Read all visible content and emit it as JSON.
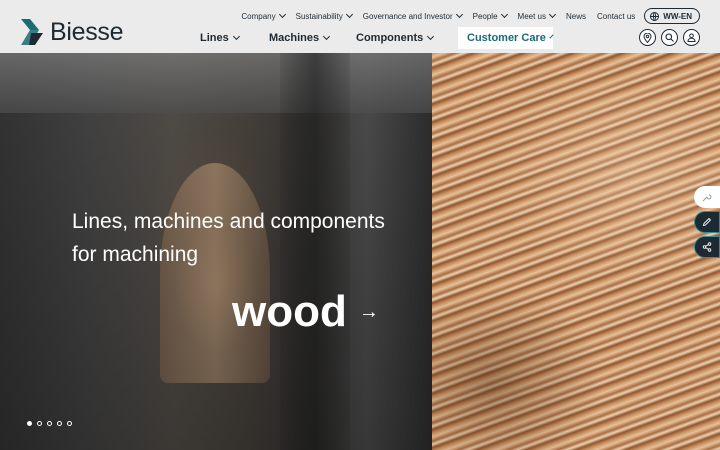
{
  "brand": {
    "name": "Biesse",
    "accent": "#1b6b73",
    "dark": "#1d2a33"
  },
  "topnav": {
    "items": [
      {
        "label": "Company",
        "dropdown": true
      },
      {
        "label": "Sustainability",
        "dropdown": true
      },
      {
        "label": "Governance and Investor",
        "dropdown": true
      },
      {
        "label": "People",
        "dropdown": true
      },
      {
        "label": "Meet us",
        "dropdown": true
      },
      {
        "label": "News",
        "dropdown": false
      },
      {
        "label": "Contact us",
        "dropdown": false
      }
    ],
    "language": "WW-EN"
  },
  "mainnav": {
    "items": [
      {
        "label": "Lines"
      },
      {
        "label": "Machines"
      },
      {
        "label": "Components"
      },
      {
        "label": "Customer Care",
        "active": true
      }
    ]
  },
  "header_icons": [
    "location-pin-icon",
    "search-icon",
    "user-icon"
  ],
  "hero": {
    "headline_line1": "Lines, machines and components",
    "headline_line2": "for machining",
    "rotating_word": "wood",
    "arrow": "→",
    "slides": 5,
    "active_slide": 0
  },
  "side_tools": [
    "wrench-icon",
    "pencil-icon",
    "share-icon"
  ]
}
